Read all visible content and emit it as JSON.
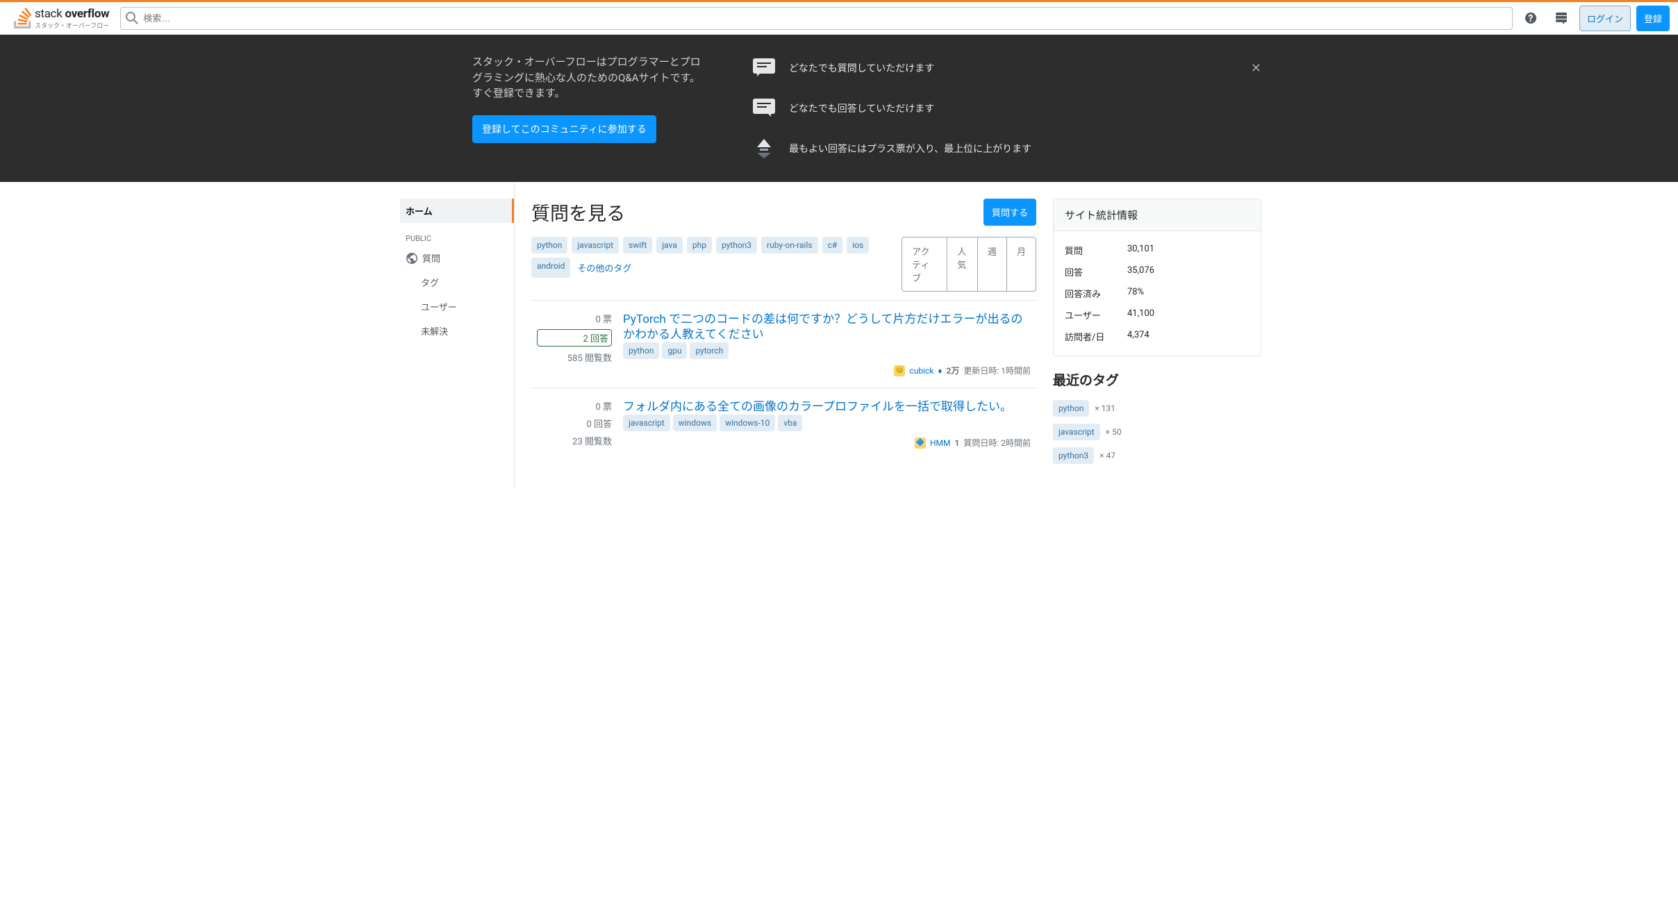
{
  "logo": {
    "main1": "stack",
    "main2": "overflow",
    "sub": "スタック・オーバーフロー"
  },
  "search": {
    "placeholder": "検索…"
  },
  "topbar": {
    "login": "ログイン",
    "signup": "登録"
  },
  "hero": {
    "desc": "スタック・オーバーフローはプログラマーとプログラミングに熱心な人のためのQ&Aサイトです。すぐ登録できます。",
    "cta": "登録してこのコミュニティに参加する",
    "features": [
      "どなたでも質問していただけます",
      "どなたでも回答していただけます",
      "最もよい回答にはプラス票が入り、最上位に上がります"
    ]
  },
  "sidebar": {
    "home": "ホーム",
    "public": "PUBLIC",
    "questions": "質問",
    "tags": "タグ",
    "users": "ユーザー",
    "unanswered": "未解決"
  },
  "main": {
    "title": "質問を見る",
    "ask": "質問する",
    "tags": [
      "python",
      "javascript",
      "swift",
      "java",
      "php",
      "python3",
      "ruby-on-rails",
      "c#",
      "ios",
      "android"
    ],
    "more_tags": "その他のタグ",
    "sort": [
      "アクティブ",
      "人気",
      "週",
      "月"
    ]
  },
  "questions": [
    {
      "votes": "0 票",
      "answers": "2 回答",
      "answered": true,
      "views": "585 閲覧数",
      "title": "PyTorch で二つのコードの差は何ですか？どうして片方だけエラーが出るのかわかる人教えてください",
      "tags": [
        "python",
        "gpu",
        "pytorch"
      ],
      "user": "cubick",
      "rep": "2万",
      "meta": "更新日時: 1時間前",
      "avatar": "😊",
      "mod": true
    },
    {
      "votes": "0 票",
      "answers": "0 回答",
      "answered": false,
      "views": "23 閲覧数",
      "title": "フォルダ内にある全ての画像のカラープロファイルを一括で取得したい。",
      "tags": [
        "javascript",
        "windows",
        "windows-10",
        "vba"
      ],
      "user": "HMM",
      "rep": "1",
      "meta": "質問日時: 2時間前",
      "avatar": "🔷",
      "mod": false
    }
  ],
  "aside": {
    "stats_title": "サイト統計情報",
    "stats": [
      {
        "label": "質問",
        "value": "30,101"
      },
      {
        "label": "回答",
        "value": "35,076"
      },
      {
        "label": "回答済み",
        "value": "78%"
      },
      {
        "label": "ユーザー",
        "value": "41,100"
      },
      {
        "label": "訪問者/日",
        "value": "4,374"
      }
    ],
    "recent_title": "最近のタグ",
    "recent_tags": [
      {
        "name": "python",
        "count": "× 131"
      },
      {
        "name": "javascript",
        "count": "× 50"
      },
      {
        "name": "python3",
        "count": "× 47"
      }
    ]
  }
}
